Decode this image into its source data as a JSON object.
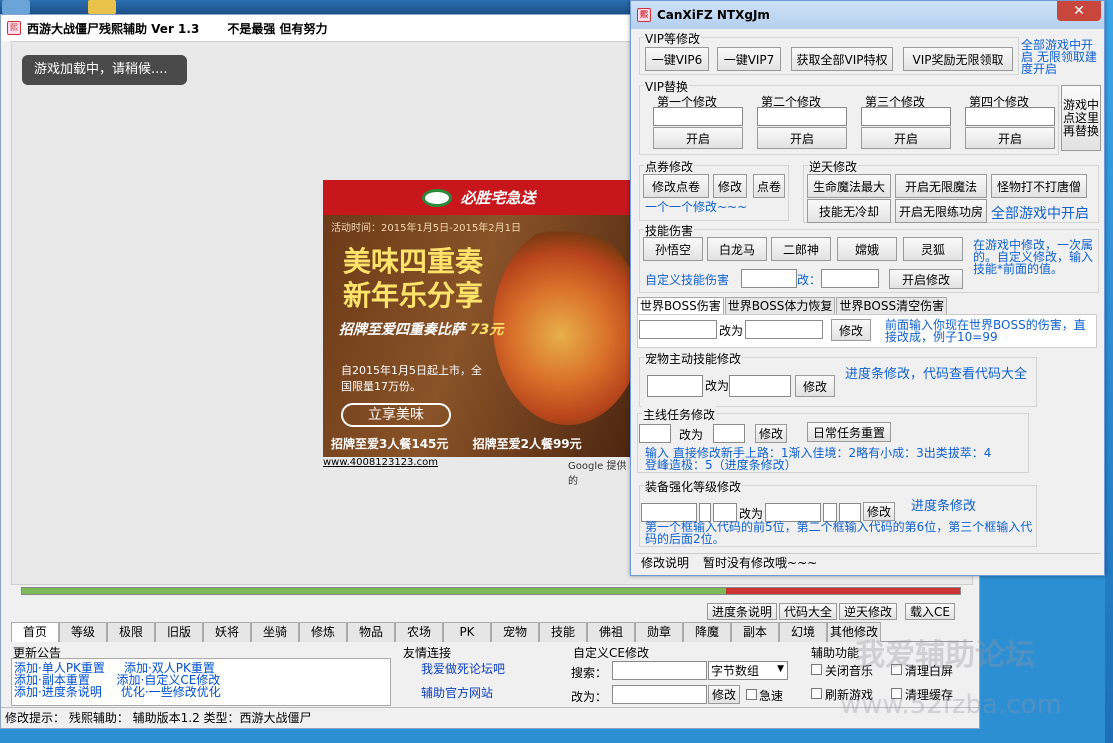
{
  "main": {
    "title": "西游大战僵尸残熙辅助 Ver  1.3",
    "slogan": "不是最强  但有努力",
    "loading": "游戏加载中，请稍候....",
    "progress": 0.75
  },
  "ad": {
    "brand": "必胜宅急送",
    "date": "活动时间：2015年1月5日-2015年2月1日",
    "headline1": "美味四重奏",
    "headline2": "新年乐分享",
    "subhead": "招牌至爱四重奏比萨",
    "price_tag": "73元",
    "desc": "自2015年1月5日起上市，全国限量17万份。",
    "button": "立享美味",
    "foot1": "招牌至爱3人餐145元",
    "foot2": "招牌至爱2人餐99元",
    "url": "www.4008123123.com",
    "google": "Google 提供的"
  },
  "subtabs": [
    "进度条说明",
    "代码大全",
    "逆天修改",
    "载入CE"
  ],
  "tabs": [
    "首页",
    "等级",
    "极限",
    "旧版",
    "妖将",
    "坐骑",
    "修炼",
    "物品",
    "农场",
    "PK",
    "宠物",
    "技能",
    "佛祖",
    "勋章",
    "降魔",
    "副本",
    "幻境",
    "其他修改"
  ],
  "news": {
    "title": "更新公告",
    "lines": [
      "添加·单人PK重置     添加·双人PK重置",
      "添加·副本重置       添加·自定义CE修改",
      "添加·进度条说明     优化·一些修改优化"
    ]
  },
  "friend": {
    "title": "友情连接",
    "link1": "我爱做死论坛吧",
    "link2": "辅助官方网站"
  },
  "ce": {
    "title": "自定义CE修改",
    "search_label": "搜索：",
    "type": "字节数组",
    "change_label": "改为：",
    "modify": "修改",
    "speed": "急速"
  },
  "aux": {
    "title": "辅助功能",
    "mute": "关闭音乐",
    "whitescreen": "清理白屏",
    "refresh": "刷新游戏",
    "cache": "清理缓存"
  },
  "status": "修改提示：  残熙辅助：  辅助版本1.2  类型：西游大战僵尸",
  "cheat": {
    "title": "CanXiFZ  NTXgJm",
    "vip": {
      "title": "VIP等修改",
      "b1": "一键VIP6",
      "b2": "一键VIP7",
      "b3": "获取全部VIP特权",
      "b4": "VIP奖励无限领取",
      "note": "全部游戏中开启 无限领取建度开启"
    },
    "vipswap": {
      "title": "VIP替换",
      "cols": [
        "第一个修改",
        "第二个修改",
        "第三个修改",
        "第四个修改"
      ],
      "open": "开启",
      "side": "游戏中点这里再替换"
    },
    "points": {
      "title": "点券修改",
      "b1": "修改点卷",
      "b2": "修改",
      "b3": "点卷",
      "note": "一个一个修改~~~"
    },
    "heaven": {
      "title": "逆天修改",
      "b1": "生命魔法最大",
      "b2": "开启无限魔法",
      "b3": "怪物打不打唐僧",
      "b4": "技能无冷却",
      "b5": "开启无限练功房",
      "note": "全部游戏中开启"
    },
    "skill": {
      "title": "技能伤害",
      "chars": [
        "孙悟空",
        "白龙马",
        "二郎神",
        "嫦娥",
        "灵狐"
      ],
      "note": "在游戏中修改，一次属的。自定义修改，输入技能*前面的值。",
      "custom": "自定义技能伤害",
      "to": "改：",
      "open": "开启修改"
    },
    "boss": {
      "tabs": [
        "世界BOSS伤害",
        "世界BOSS体力恢复",
        "世界BOSS清空伤害"
      ],
      "to": "改为",
      "modify": "修改",
      "note": "前面输入你现在世界BOSS的伤害，直接改成，例子10=99"
    },
    "pet": {
      "title": "宠物主动技能修改",
      "to": "改为",
      "modify": "修改",
      "note": "进度条修改，代码查看代码大全"
    },
    "quest": {
      "title": "主线任务修改",
      "to": "改为",
      "modify": "修改",
      "daily": "日常任务重置",
      "note": "输入 直接修改新手上路：1渐入佳境：2略有小成：3出类拔萃：4登峰造极：5（进度条修改）"
    },
    "equip": {
      "title": "装备强化等级修改",
      "to": "改为",
      "modify": "修改",
      "side": "进度条修改",
      "note": "第一个框输入代码的前5位，第二个框输入代码的第6位，第三个框输入代码的后面2位。"
    },
    "footer": {
      "label": "修改说明",
      "text": "暂时没有修改哦~~~"
    }
  },
  "watermark": {
    "line1": "我爱辅助论坛",
    "line2": "www.52fzba.com"
  }
}
